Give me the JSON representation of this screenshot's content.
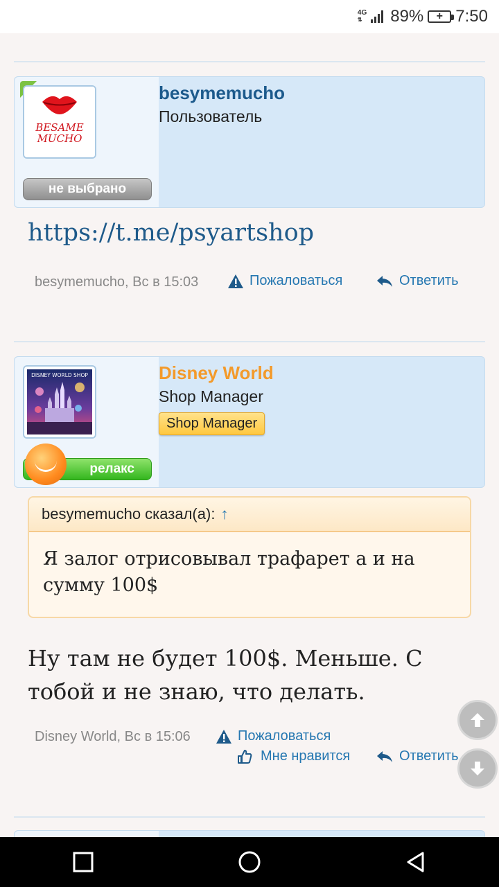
{
  "status_bar": {
    "network": "4G",
    "battery": "89%",
    "time": "7:50"
  },
  "posts": [
    {
      "username": "besymemucho",
      "user_title": "Пользователь",
      "status_label": "не выбрано",
      "avatar_text_line1": "BESAME",
      "avatar_text_line2": "MUCHO",
      "content_link": "https://t.me/psyartshop",
      "meta": "besymemucho, Вс в 15:03",
      "report_label": "Пожаловаться",
      "reply_label": "Ответить",
      "colors": {
        "username": "#1c5a8c"
      }
    },
    {
      "username": "Disney World",
      "user_title": "Shop Manager",
      "banner": "Shop Manager",
      "status_label": "релакс",
      "avatar_text": "DISNEY WORLD SHOP",
      "quote_author": "besymemucho сказал(а):",
      "quote_arrow": "↑",
      "quote_text": "Я залог отрисовывал трафарет а и на сумму 100$",
      "message": "Ну там не будет 100$. Меньше. С тобой и не знаю, что делать.",
      "meta": "Disney World, Вс в 15:06",
      "report_label": "Пожаловаться",
      "like_label": "Мне нравится",
      "reply_label": "Ответить",
      "colors": {
        "username": "#f39a2b"
      }
    }
  ],
  "icons": {
    "report": "warning-icon",
    "reply": "reply-icon",
    "like": "thumbs-up-icon",
    "scroll_up": "arrow-up-icon",
    "scroll_down": "arrow-down-icon"
  },
  "colors": {
    "link": "#1e5a8a",
    "action": "#2577b1",
    "background": "#f8f4f3"
  }
}
